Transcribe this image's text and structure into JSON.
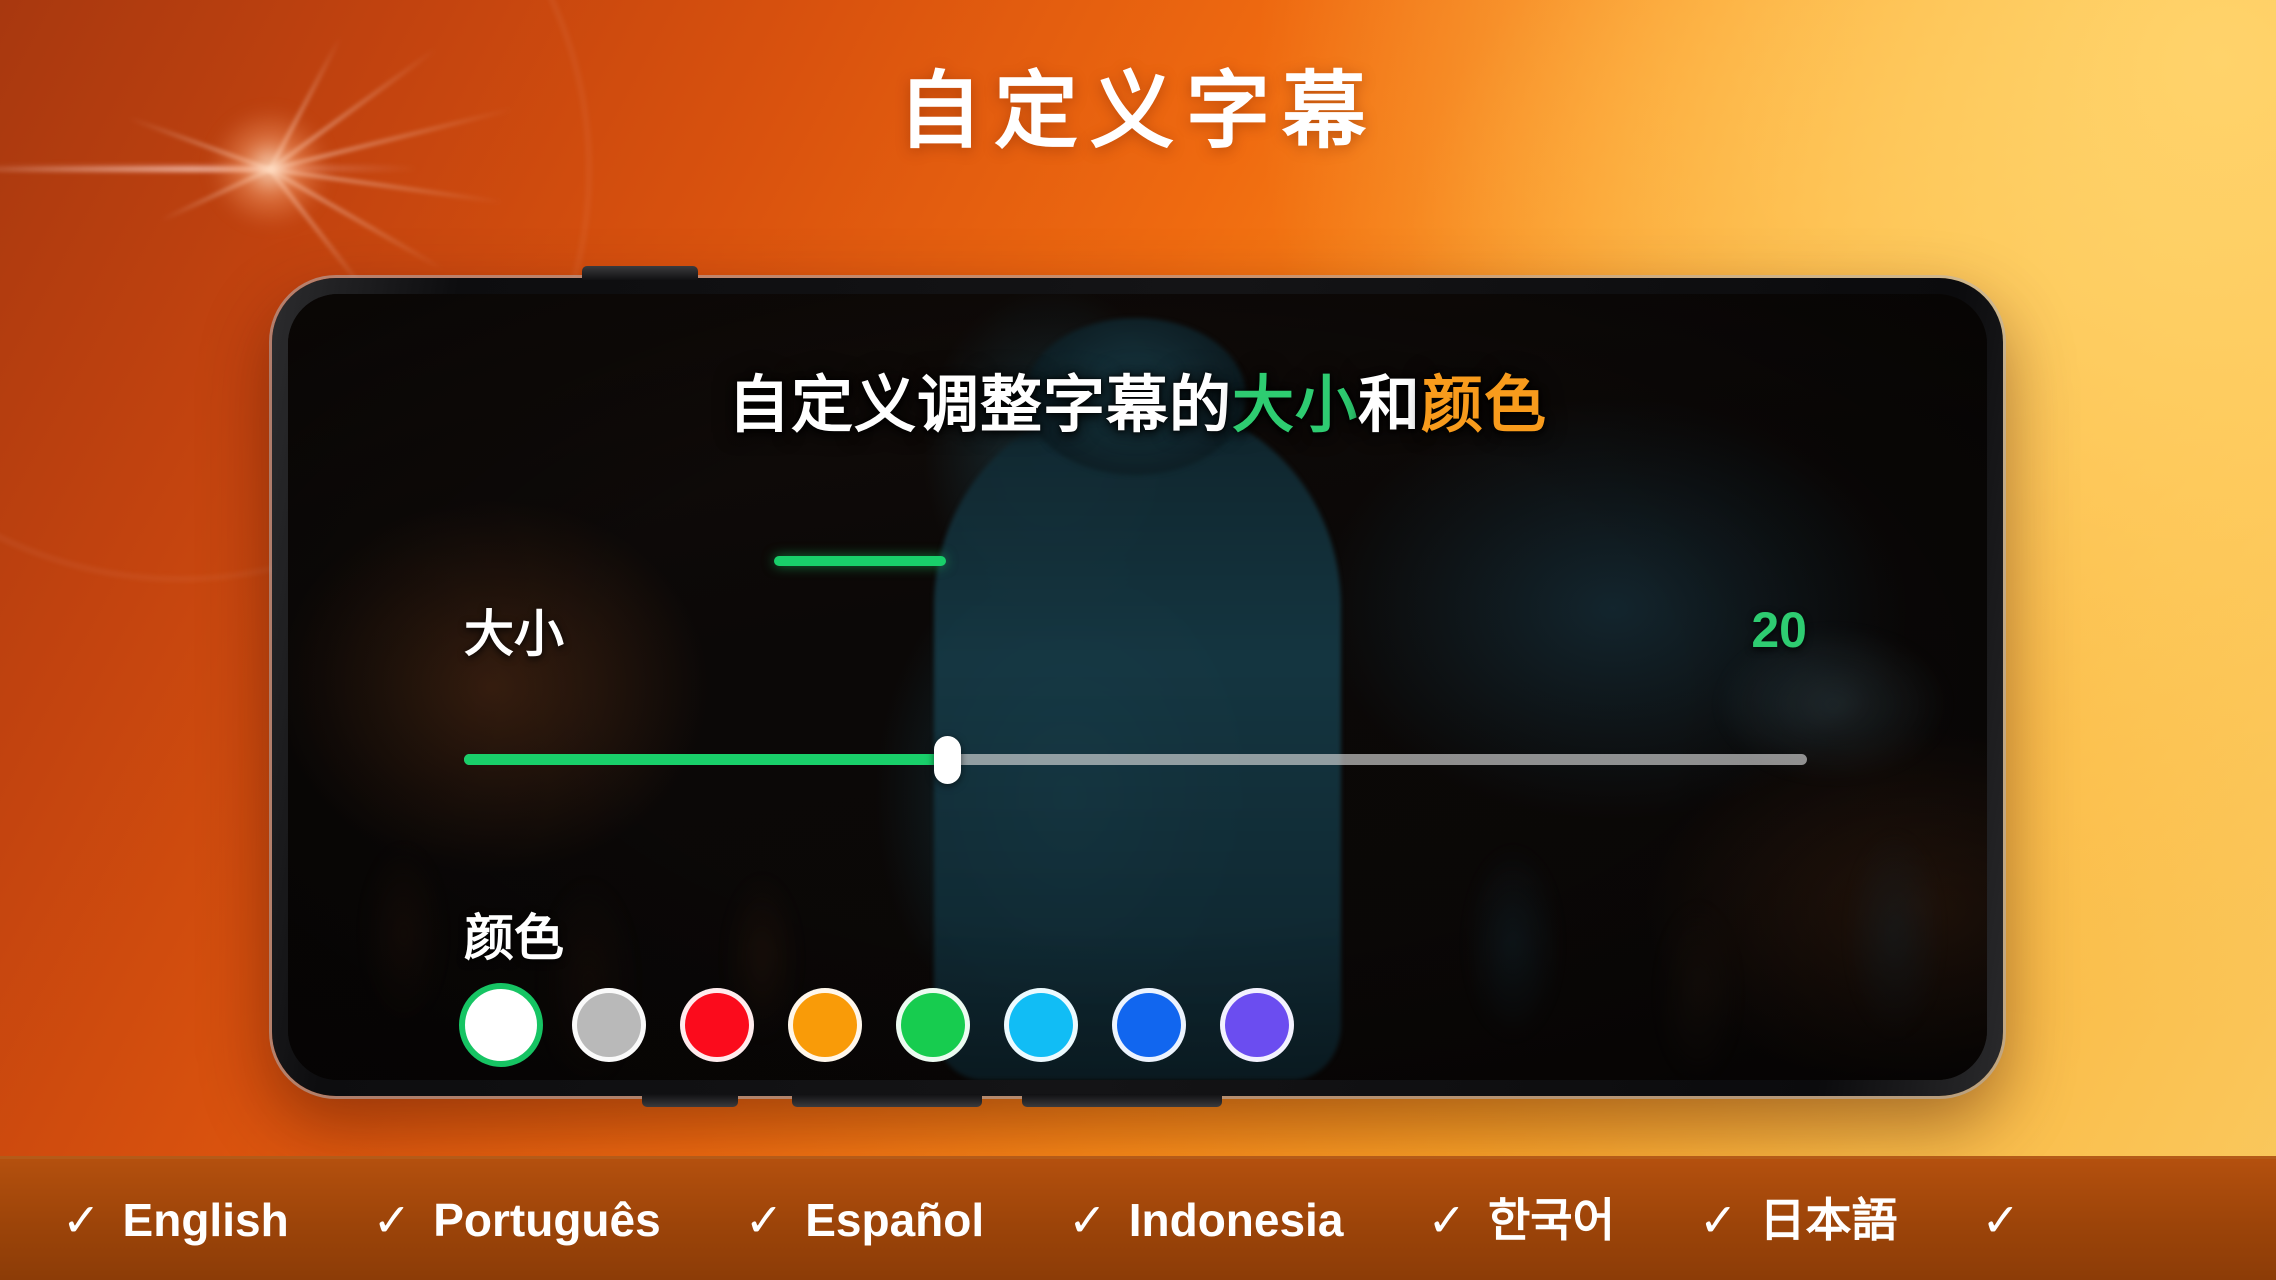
{
  "headline": "自定义字幕",
  "phone": {
    "subtitle_preview": {
      "part1": "自定义调整字幕的",
      "part2": "大小",
      "part3": "和",
      "part4": "颜色",
      "color_part2": "#2ecc71",
      "color_part4": "#f89b1c"
    },
    "size": {
      "label": "大小",
      "value": "20",
      "value_color": "#2ecc71",
      "slider_percent": 36,
      "track_color": "#19cf6a"
    },
    "color": {
      "label": "颜色",
      "selected_index": 0,
      "ring_color": "#16c463",
      "swatches": [
        {
          "name": "white",
          "hex": "#ffffff"
        },
        {
          "name": "gray",
          "hex": "#b9b9b9"
        },
        {
          "name": "red",
          "hex": "#fb0b1c"
        },
        {
          "name": "orange",
          "hex": "#f99b08"
        },
        {
          "name": "green",
          "hex": "#17cc4f"
        },
        {
          "name": "cyan",
          "hex": "#11bdf5"
        },
        {
          "name": "blue",
          "hex": "#1166ef"
        },
        {
          "name": "purple",
          "hex": "#6b4df0"
        }
      ]
    }
  },
  "language_bar": {
    "check_glyph": "✓",
    "items": [
      {
        "label": "English"
      },
      {
        "label": "Português"
      },
      {
        "label": "Español"
      },
      {
        "label": "Indonesia"
      },
      {
        "label": "한국어"
      },
      {
        "label": "日本語"
      },
      {
        "label": ""
      }
    ]
  }
}
